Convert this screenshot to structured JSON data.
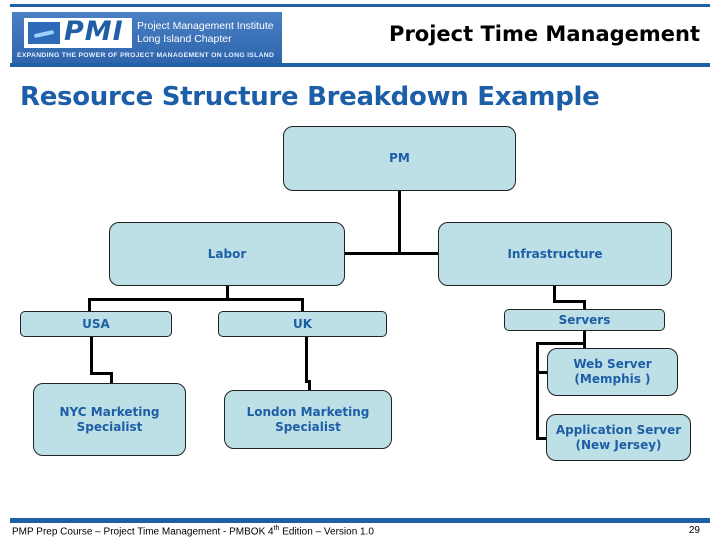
{
  "header": {
    "logo": {
      "mark": "PMI",
      "line1": "Project Management Institute",
      "line2": "Long Island Chapter",
      "tagline": "Expanding the Power of Project Management on Long Island"
    },
    "title": "Project Time Management"
  },
  "slide": {
    "title": "Resource Structure Breakdown Example"
  },
  "rbs": {
    "root": "PM",
    "labor": "Labor",
    "infrastructure": "Infrastructure",
    "usa": "USA",
    "uk": "UK",
    "servers": "Servers",
    "nyc_marketing": "NYC Marketing\nSpecialist",
    "london_marketing": "London Marketing\nSpecialist",
    "web_server": "Web Server\n(Memphis )",
    "app_server": "Application Server\n(New Jersey)"
  },
  "colors": {
    "accent_blue": "#1f5fa5",
    "node_fill": "#bde0e6",
    "node_text": "#1e5ea6"
  },
  "footer": {
    "course_prefix": "PMP Prep Course – Project Time Management - PMBOK 4",
    "course_sup": "th",
    "course_suffix": " Edition – Version 1.0",
    "page_number": "29"
  }
}
